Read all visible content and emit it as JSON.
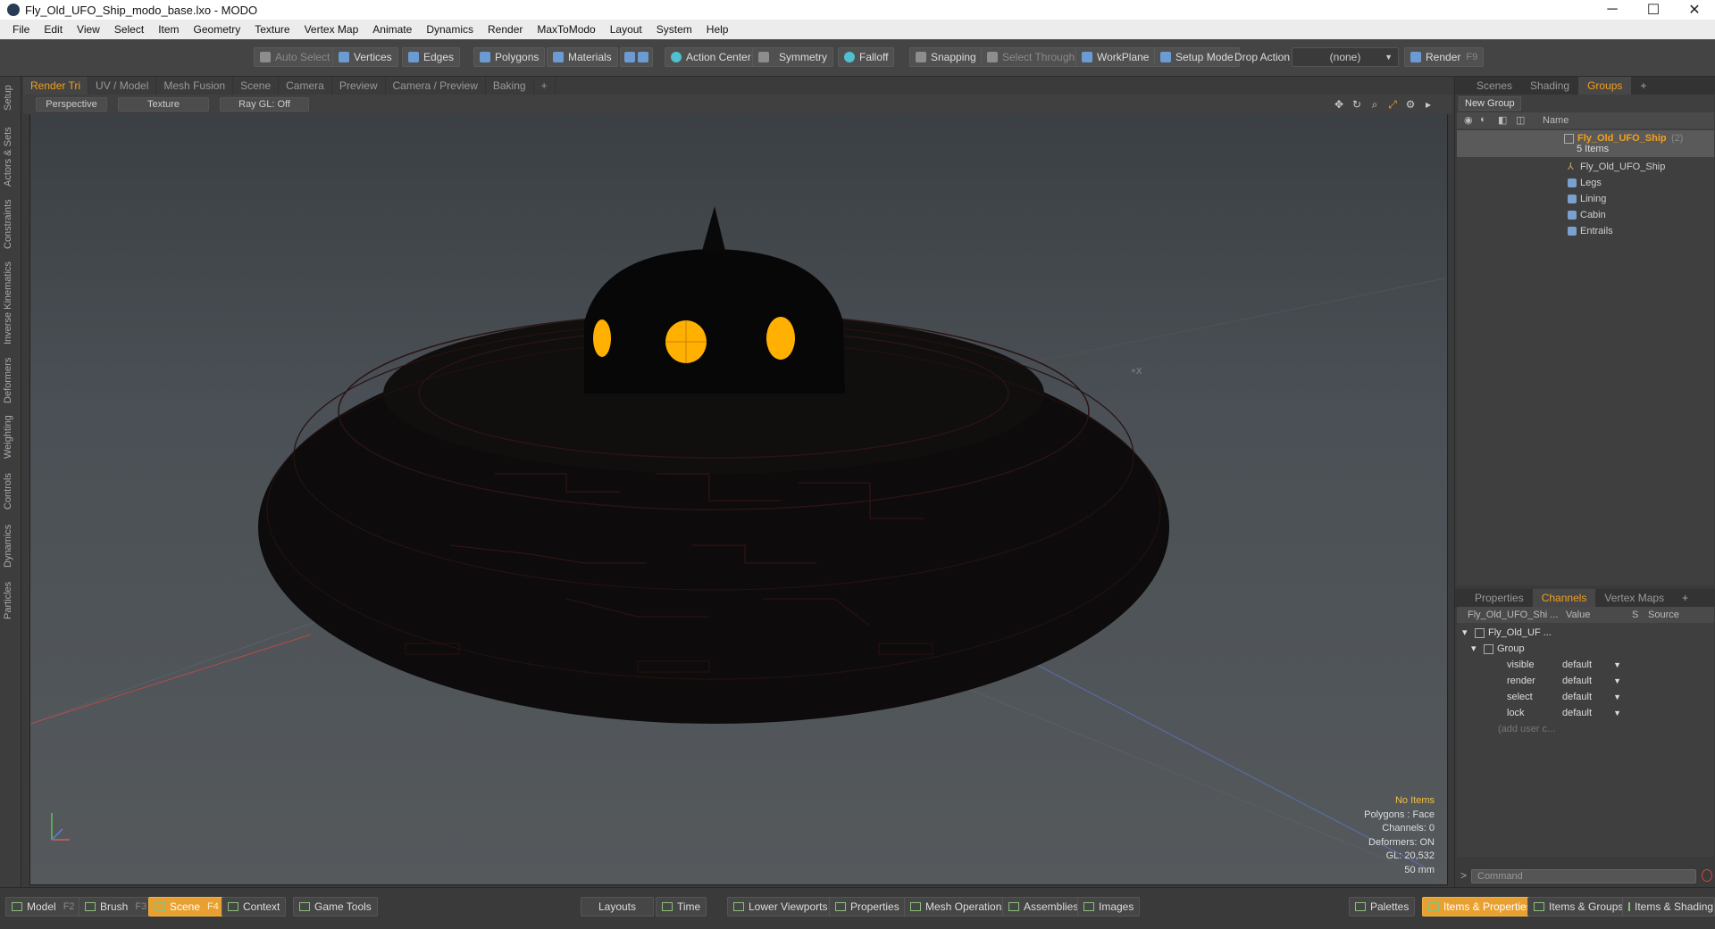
{
  "window": {
    "title": "Fly_Old_UFO_Ship_modo_base.lxo - MODO",
    "minimize": "─",
    "maximize": "☐",
    "close": "✕"
  },
  "menu": [
    "File",
    "Edit",
    "View",
    "Select",
    "Item",
    "Geometry",
    "Texture",
    "Vertex Map",
    "Animate",
    "Dynamics",
    "Render",
    "MaxToModo",
    "Layout",
    "System",
    "Help"
  ],
  "toolbar": {
    "auto_select": "Auto Select",
    "vertices": "Vertices",
    "edges": "Edges",
    "polygons": "Polygons",
    "materials": "Materials",
    "action_center": "Action Center",
    "symmetry": "Symmetry",
    "falloff": "Falloff",
    "snapping": "Snapping",
    "select_through": "Select Through",
    "workplane": "WorkPlane",
    "setup_mode": "Setup Mode",
    "drop_action_label": "Drop Action",
    "drop_action_value": "(none)",
    "render": "Render",
    "render_key": "F9"
  },
  "left_tabs": [
    "Setup",
    "Actors & Sets",
    "Constraints",
    "Inverse Kinematics",
    "Deformers",
    "Weighting",
    "Controls",
    "Dynamics",
    "Particles"
  ],
  "viewport_tabs": {
    "tabs": [
      "Render Tri",
      "UV / Model",
      "Mesh Fusion",
      "Scene",
      "Camera",
      "Preview",
      "Camera / Preview",
      "Baking"
    ],
    "active": "Render Tri",
    "add": "+"
  },
  "viewport_tools": {
    "view": "Perspective",
    "shading": "Texture",
    "raygl": "Ray GL: Off"
  },
  "viewport_info": {
    "selection": "No Items",
    "polygons": "Polygons : Face",
    "channels": "Channels: 0",
    "deformers": "Deformers: ON",
    "gl": "GL: 20,532",
    "lens": "50 mm"
  },
  "axis_labels": {
    "neg_z": "-Z",
    "pos_x": "+X"
  },
  "right_top_tabs": {
    "tabs": [
      "Scenes",
      "Shading",
      "Groups"
    ],
    "active": "Groups",
    "add": "+"
  },
  "groups": {
    "new_group": "New Group",
    "name_header": "Name",
    "root": {
      "name": "Fly_Old_UFO_Ship",
      "count": "(2)",
      "sub": "5 Items"
    },
    "items": [
      {
        "name": "Fly_Old_UFO_Ship",
        "icon": "locator-icon"
      },
      {
        "name": "Legs",
        "icon": "mesh-icon"
      },
      {
        "name": "Lining",
        "icon": "mesh-icon"
      },
      {
        "name": "Cabin",
        "icon": "mesh-icon"
      },
      {
        "name": "Entrails",
        "icon": "mesh-icon"
      }
    ]
  },
  "right_bottom_tabs": {
    "tabs": [
      "Properties",
      "Channels",
      "Vertex Maps"
    ],
    "active": "Channels",
    "add": "+"
  },
  "channels": {
    "headers": {
      "name": "Fly_Old_UFO_Shi ...",
      "value": "Value",
      "s": "S",
      "source": "Source"
    },
    "root": "Fly_Old_UF ...",
    "group": "Group",
    "rows": [
      {
        "name": "visible",
        "value": "default"
      },
      {
        "name": "render",
        "value": "default"
      },
      {
        "name": "select",
        "value": "default"
      },
      {
        "name": "lock",
        "value": "default"
      }
    ],
    "add_user": "(add user c..."
  },
  "command": {
    "placeholder": "Command",
    "prompt": ">"
  },
  "bottom": {
    "model": "Model",
    "model_key": "F2",
    "brush": "Brush",
    "brush_key": "F3",
    "scene": "Scene",
    "scene_key": "F4",
    "context": "Context",
    "game_tools": "Game Tools",
    "layouts": "Layouts",
    "time": "Time",
    "lower_viewports": "Lower Viewports",
    "properties": "Properties",
    "mesh_operations": "Mesh Operations",
    "assemblies": "Assemblies",
    "images": "Images",
    "palettes": "Palettes",
    "items_properties": "Items & Properties",
    "items_groups": "Items & Groups",
    "items_shading": "Items & Shading"
  },
  "colors": {
    "accent": "#f0a020",
    "window_glow": "#ffb000"
  }
}
